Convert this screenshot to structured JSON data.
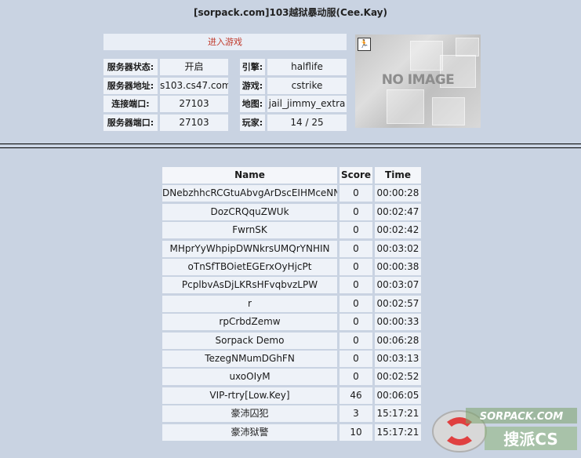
{
  "title": "[sorpack.com]103越狱暴动服(Cee.Kay)",
  "enter_game": "进入游戏",
  "info": {
    "status_label": "服务器状态:",
    "status_value": "开启",
    "address_label": "服务器地址:",
    "address_value": "s103.cs47.com",
    "conn_port_label": "连接端口:",
    "conn_port_value": "27103",
    "server_port_label": "服务器端口:",
    "server_port_value": "27103",
    "engine_label": "引擎:",
    "engine_value": "halflife",
    "game_label": "游戏:",
    "game_value": "cstrike",
    "map_label": "地图:",
    "map_value": "jail_jimmy_extra",
    "players_label": "玩家:",
    "players_value": "14 / 25"
  },
  "map_image": {
    "text": "NO IMAGE",
    "icon": "counter-strike-icon"
  },
  "players": {
    "headers": {
      "name": "Name",
      "score": "Score",
      "time": "Time"
    },
    "rows": [
      {
        "name": "DNebzhhcRCGtuAbvgArDscEIHMceNNH",
        "score": "0",
        "time": "00:00:28"
      },
      {
        "name": "DozCRQquZWUk",
        "score": "0",
        "time": "00:02:47"
      },
      {
        "name": "FwrnSK",
        "score": "0",
        "time": "00:02:42"
      },
      {
        "name": "MHprYyWhpipDWNkrsUMQrYNHIN",
        "score": "0",
        "time": "00:03:02"
      },
      {
        "name": "oTnSfTBOietEGErxOyHjcPt",
        "score": "0",
        "time": "00:00:38"
      },
      {
        "name": "PcplbvAsDjLKRsHFvqbvzLPW",
        "score": "0",
        "time": "00:03:07"
      },
      {
        "name": "r",
        "score": "0",
        "time": "00:02:57"
      },
      {
        "name": "rpCrbdZemw",
        "score": "0",
        "time": "00:00:33"
      },
      {
        "name": "Sorpack Demo",
        "score": "0",
        "time": "00:06:28"
      },
      {
        "name": "TezegNMumDGhFN",
        "score": "0",
        "time": "00:03:13"
      },
      {
        "name": "uxoOIyM",
        "score": "0",
        "time": "00:02:52"
      },
      {
        "name": "VIP-rtry[Low.Key]",
        "score": "46",
        "time": "00:06:05"
      },
      {
        "name": "豪沛囚犯",
        "score": "3",
        "time": "15:17:21"
      },
      {
        "name": "豪沛狱警",
        "score": "10",
        "time": "15:17:21"
      }
    ]
  },
  "watermark": {
    "site": "SORPACK.COM",
    "brand": "搜派CS"
  }
}
